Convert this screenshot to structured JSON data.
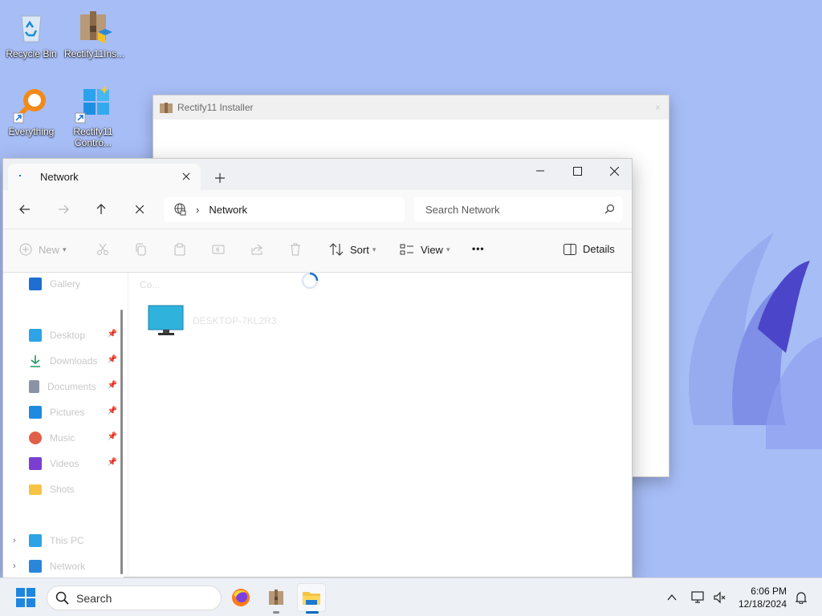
{
  "desktop": {
    "icons": [
      {
        "label": "Recycle Bin",
        "icon": "recycle-bin-icon"
      },
      {
        "label": "Rectify11Ins...",
        "icon": "installer-package-icon"
      },
      {
        "label": "Everything",
        "icon": "everything-search-icon"
      },
      {
        "label": "Rectify11 Contro...",
        "icon": "windows-logo-icon"
      }
    ]
  },
  "installer_window": {
    "title": "Rectify11 Installer",
    "close": "×"
  },
  "explorer": {
    "tab": {
      "title": "Network"
    },
    "address": {
      "location": "Network",
      "separator": "›"
    },
    "search": {
      "placeholder": "Search Network"
    },
    "commands": {
      "new": "New",
      "sort": "Sort",
      "view": "View",
      "more": "•••",
      "details": "Details"
    },
    "sidebar": {
      "items": [
        {
          "label": "Gallery",
          "icon": "gallery-icon",
          "pinned": false
        },
        {
          "label": "Desktop",
          "icon": "desktop-icon",
          "pinned": true
        },
        {
          "label": "Downloads",
          "icon": "downloads-icon",
          "pinned": true
        },
        {
          "label": "Documents",
          "icon": "documents-icon",
          "pinned": true
        },
        {
          "label": "Pictures",
          "icon": "pictures-icon",
          "pinned": true
        },
        {
          "label": "Music",
          "icon": "music-icon",
          "pinned": true
        },
        {
          "label": "Videos",
          "icon": "videos-icon",
          "pinned": true
        },
        {
          "label": "Shots",
          "icon": "folder-icon",
          "pinned": false
        },
        {
          "label": "This PC",
          "icon": "this-pc-icon",
          "pinned": false
        },
        {
          "label": "Network",
          "icon": "network-icon",
          "pinned": false
        }
      ]
    },
    "content": {
      "group_label": "Co...",
      "computer_name": "DESKTOP-7KL2R3",
      "loading": true
    }
  },
  "taskbar": {
    "search_label": "Search",
    "time": "6:06 PM",
    "date": "12/18/2024",
    "apps": [
      "firefox-icon",
      "installer-package-icon",
      "file-explorer-icon"
    ]
  },
  "colors": {
    "wallpaper": "#a7bdf6",
    "accent": "#0067c0",
    "taskbar": "#edf0f5"
  }
}
